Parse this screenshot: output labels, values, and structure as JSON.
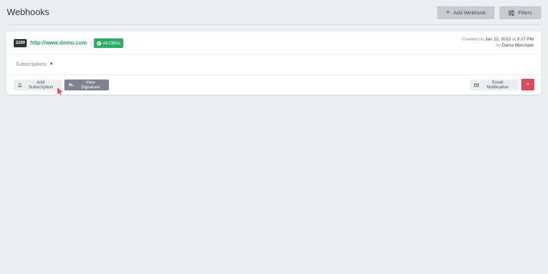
{
  "header": {
    "title": "Webhooks",
    "add_webhook_label": "Add Webhook",
    "filters_label": "Filters"
  },
  "webhook": {
    "id": "2299",
    "url": "http://www.demo.com",
    "separator": "|",
    "dba_label": "All DBAs",
    "created_prefix": "Created on",
    "created_date": "Jan 12, 2023",
    "created_at_word": "at",
    "created_time": "3:17 PM",
    "created_by_prefix": "by",
    "created_by": "Demo Merchant",
    "subscriptions_label": "Subscriptions",
    "actions": {
      "add_subscription_label": "Add Subscription",
      "view_signature_label": "View Signature",
      "email_notification_label": "Email Notification",
      "delete_label": "×"
    }
  },
  "colors": {
    "accent_green": "#2eaa64",
    "danger_red": "#e0495a",
    "url_green": "#2f9a5a",
    "cursor_red": "#e0495a"
  }
}
